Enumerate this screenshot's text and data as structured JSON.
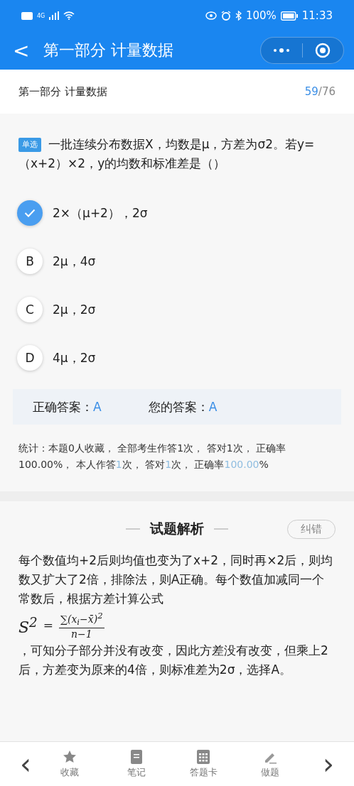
{
  "status_bar": {
    "network": "4G",
    "battery": "100%",
    "time": "11:33"
  },
  "nav_bar": {
    "back": "<",
    "title": "第一部分 计量数据"
  },
  "header": {
    "section": "第一部分 计量数据",
    "current": "59",
    "total": "/76"
  },
  "question": {
    "type_tag": "单选",
    "text": "一批连续分布数据X，均数是μ，方差为σ2。若y=（x+2）×2，y的均数和标准差是（）"
  },
  "options": [
    {
      "text": "2×（μ+2），2σ",
      "selected": true
    },
    {
      "letter": "B",
      "text": "2μ，4σ",
      "selected": false
    },
    {
      "letter": "C",
      "text": "2μ，2σ",
      "selected": false
    },
    {
      "letter": "D",
      "text": "4μ，2σ",
      "selected": false
    }
  ],
  "answers": {
    "correct_label": "正确答案：",
    "correct": "A",
    "yours_label": "您的答案：",
    "yours": "A"
  },
  "stats": [
    {
      "text": "统计：本题0人收藏， 全部考生作答1次， 答对1次， 正确率100.00%， 本人作答",
      "highlight": false
    },
    {
      "text": "1",
      "highlight": true
    },
    {
      "text": "次， 答对",
      "highlight": false
    },
    {
      "text": "1",
      "highlight": true
    },
    {
      "text": "次， 正确率",
      "highlight": false
    },
    {
      "text": "100.00",
      "highlight": true
    },
    {
      "text": "%",
      "highlight": false
    }
  ],
  "analysis": {
    "title": "试题解析",
    "report_button": "纠错",
    "text_before": "每个数值均+2后则均值也变为了x+2，同时再×2后，则均数又扩大了2倍，排除法，则A正确。每个数值加减同一个常数后，根据方差计算公式",
    "formula": {
      "lhs": "S$^{2}$",
      "equals": "=",
      "numerator": "∑(x$_{i}$−x̄)$^{2}$",
      "denominator": "n−1"
    },
    "text_after": "，可知分子部分并没有改变，因此方差没有改变，但乘上2后，方差变为原来的4倍，则标准差为2σ，选择A。"
  },
  "bottom_bar": {
    "prev": "‹",
    "next": "›",
    "items": [
      {
        "kind": "star",
        "label": "收藏"
      },
      {
        "kind": "notebook",
        "label": "笔记"
      },
      {
        "kind": "grid",
        "label": "答题卡"
      },
      {
        "kind": "pencil",
        "label": "做题"
      }
    ]
  }
}
